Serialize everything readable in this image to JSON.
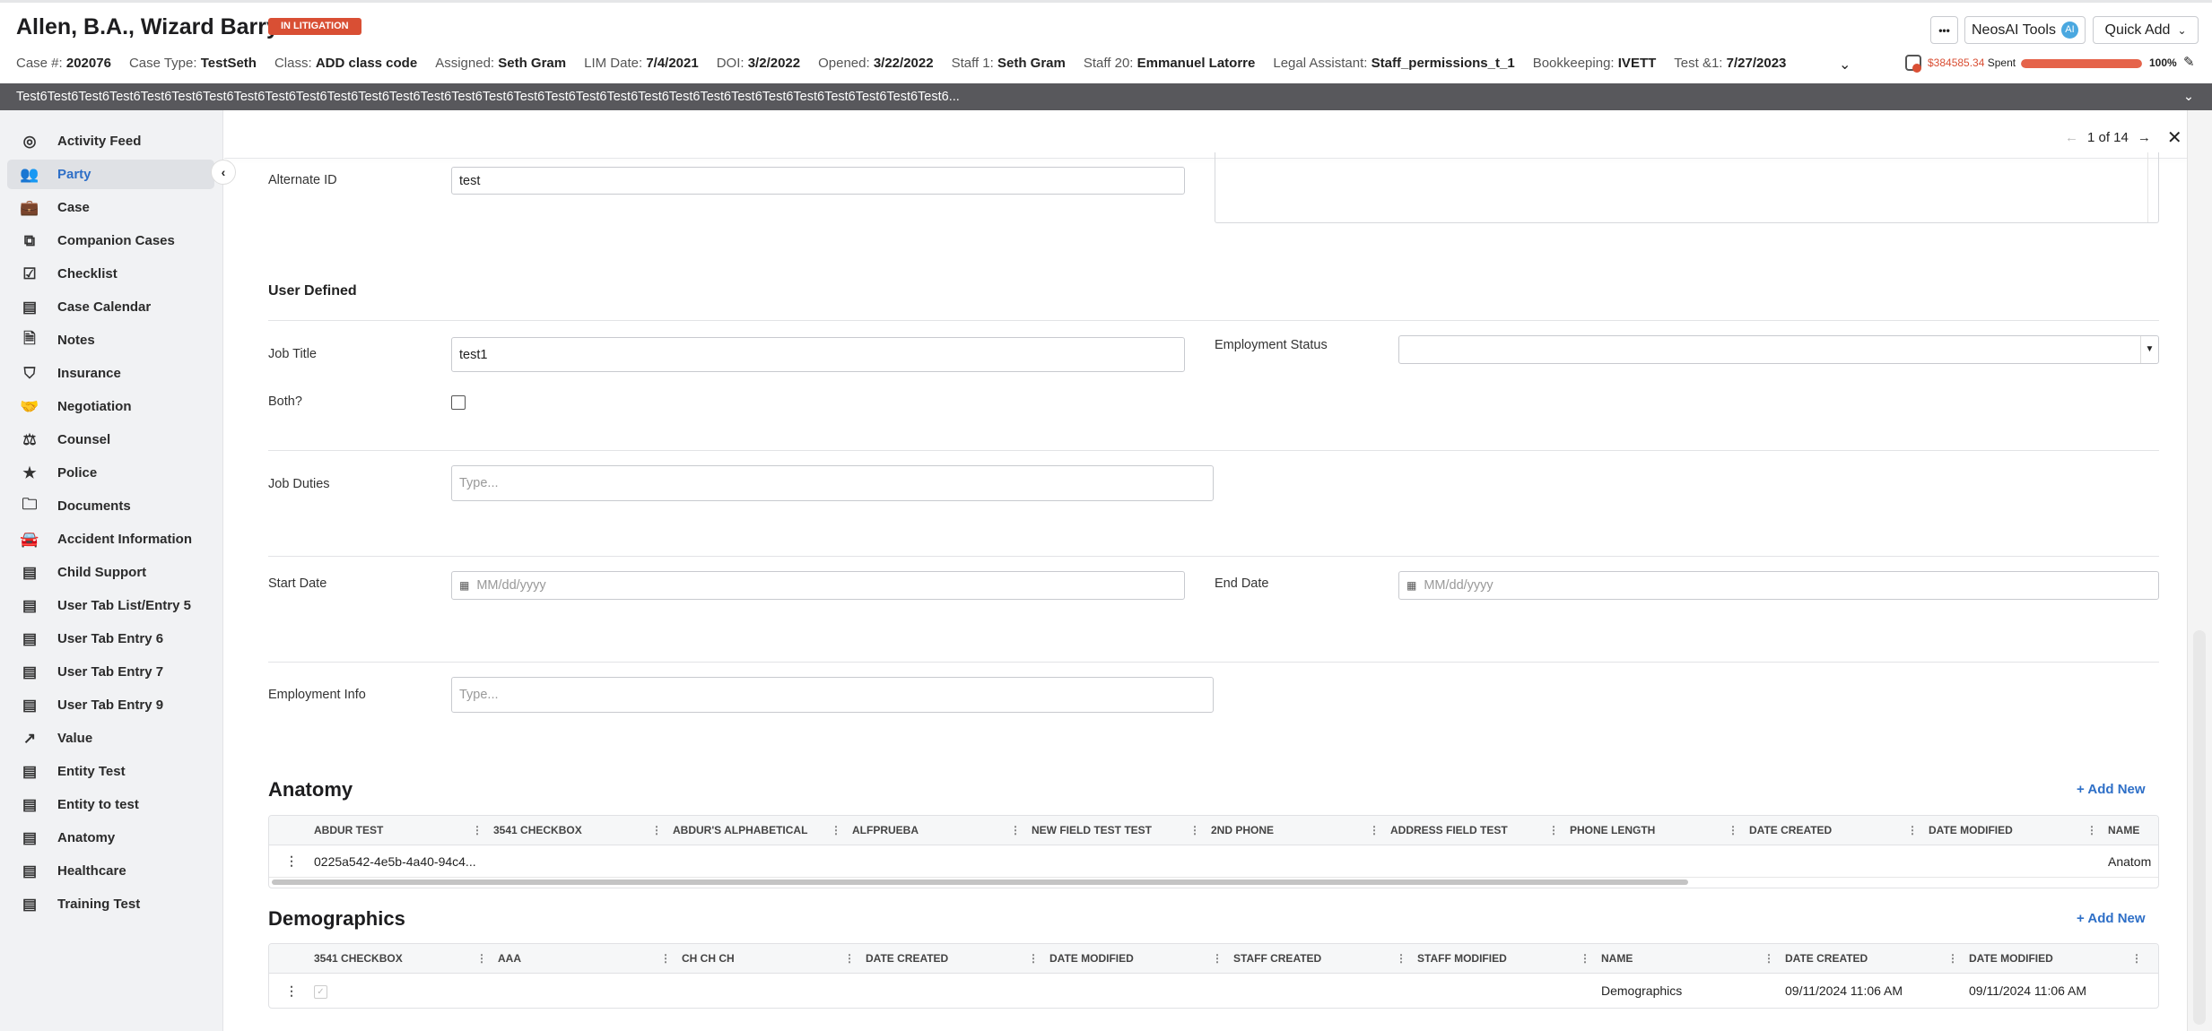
{
  "header": {
    "title": "Allen, B.A., Wizard Barry T.",
    "status_badge": "IN LITIGATION",
    "info": [
      {
        "label": "Case #:",
        "value": "202076"
      },
      {
        "label": "Case Type:",
        "value": "TestSeth"
      },
      {
        "label": "Class:",
        "value": "ADD class code"
      },
      {
        "label": "Assigned:",
        "value": "Seth Gram"
      },
      {
        "label": "LIM Date:",
        "value": "7/4/2021"
      },
      {
        "label": "DOI:",
        "value": "3/2/2022"
      },
      {
        "label": "Opened:",
        "value": "3/22/2022"
      },
      {
        "label": "Staff 1:",
        "value": "Seth Gram"
      },
      {
        "label": "Staff 20:",
        "value": "Emmanuel Latorre"
      },
      {
        "label": "Legal Assistant:",
        "value": "Staff_permissions_t_1"
      },
      {
        "label": "Bookkeeping:",
        "value": "IVETT"
      },
      {
        "label": "Test &1:",
        "value": "7/27/2023"
      }
    ],
    "more_label": "•••",
    "ai_tools_label": "NeosAI Tools",
    "ai_badge": "AI",
    "quick_add_label": "Quick Add",
    "budget": {
      "amount": "$384585.34",
      "spent_label": "Spent",
      "percent_label": "100%",
      "percent": 100,
      "color": "#e5634a"
    },
    "banner": "Test6Test6Test6Test6Test6Test6Test6Test6Test6Test6Test6Test6Test6Test6Test6Test6Test6Test6Test6Test6Test6Test6Test6Test6Test6Test6Test6Test6Test6Test6..."
  },
  "sidebar": {
    "items": [
      {
        "label": "Activity Feed",
        "icon": "activity-icon"
      },
      {
        "label": "Party",
        "icon": "party-icon",
        "active": true
      },
      {
        "label": "Case",
        "icon": "case-icon"
      },
      {
        "label": "Companion Cases",
        "icon": "companion-icon"
      },
      {
        "label": "Checklist",
        "icon": "checklist-icon"
      },
      {
        "label": "Case Calendar",
        "icon": "calendar-icon"
      },
      {
        "label": "Notes",
        "icon": "notes-icon"
      },
      {
        "label": "Insurance",
        "icon": "shield-icon"
      },
      {
        "label": "Negotiation",
        "icon": "handshake-icon"
      },
      {
        "label": "Counsel",
        "icon": "scale-icon"
      },
      {
        "label": "Police",
        "icon": "badge-icon"
      },
      {
        "label": "Documents",
        "icon": "folder-icon"
      },
      {
        "label": "Accident Information",
        "icon": "car-icon"
      },
      {
        "label": "Child Support",
        "icon": "list-icon"
      },
      {
        "label": "User Tab List/Entry 5",
        "icon": "list-icon"
      },
      {
        "label": "User Tab Entry 6",
        "icon": "list-icon"
      },
      {
        "label": "User Tab Entry 7",
        "icon": "list-icon"
      },
      {
        "label": "User Tab Entry 9",
        "icon": "list-icon"
      },
      {
        "label": "Value",
        "icon": "trend-icon"
      },
      {
        "label": "Entity Test",
        "icon": "list-icon"
      },
      {
        "label": "Entity to test",
        "icon": "list-icon"
      },
      {
        "label": "Anatomy",
        "icon": "list-icon"
      },
      {
        "label": "Healthcare",
        "icon": "list-icon"
      },
      {
        "label": "Training Test",
        "icon": "list-icon"
      }
    ]
  },
  "pager": {
    "text": "1 of 14"
  },
  "form": {
    "alternate_id": {
      "label": "Alternate ID",
      "value": "test"
    },
    "user_defined_title": "User Defined",
    "job_title": {
      "label": "Job Title",
      "value": "test1"
    },
    "employment_status": {
      "label": "Employment Status",
      "value": ""
    },
    "both": {
      "label": "Both?",
      "checked": false
    },
    "job_duties": {
      "label": "Job Duties",
      "placeholder": "Type..."
    },
    "start_date": {
      "label": "Start Date",
      "placeholder": "MM/dd/yyyy"
    },
    "end_date": {
      "label": "End Date",
      "placeholder": "MM/dd/yyyy"
    },
    "employment_info": {
      "label": "Employment Info",
      "placeholder": "Type..."
    }
  },
  "anatomy": {
    "title": "Anatomy",
    "add_new": "+ Add New",
    "columns": [
      "ABDUR TEST",
      "3541 CHECKBOX",
      "ABDUR'S ALPHABETICAL",
      "ALFPRUEBA",
      "NEW FIELD TEST TEST",
      "2ND PHONE",
      "ADDRESS FIELD TEST",
      "PHONE LENGTH",
      "DATE CREATED",
      "DATE MODIFIED",
      "NAME"
    ],
    "rows": [
      [
        "0225a542-4e5b-4a40-94c4...",
        "",
        "",
        "",
        "",
        "",
        "",
        "",
        "",
        "",
        "Anatom"
      ]
    ]
  },
  "demographics": {
    "title": "Demographics",
    "add_new": "+ Add New",
    "columns": [
      "3541 CHECKBOX",
      "AAA",
      "CH CH CH",
      "DATE CREATED",
      "DATE MODIFIED",
      "STAFF CREATED",
      "STAFF MODIFIED",
      "NAME",
      "DATE CREATED",
      "DATE MODIFIED"
    ],
    "rows": [
      {
        "checkbox": true,
        "cells": [
          "",
          "",
          "",
          "",
          "",
          "",
          "",
          "Demographics",
          "09/11/2024 11:06 AM",
          "09/11/2024 11:06 AM"
        ]
      }
    ]
  }
}
